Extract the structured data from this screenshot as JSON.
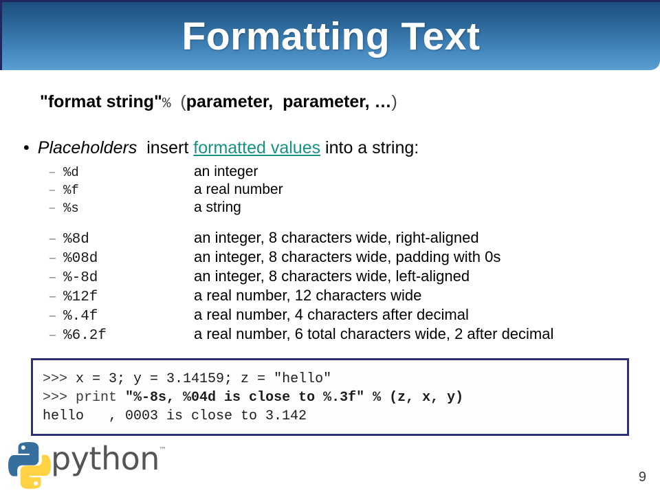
{
  "slide": {
    "title": "Formatting Text",
    "page_number": "9",
    "accent_banner_top": "#1d4f7e",
    "accent_banner_bottom": "#59a0d4",
    "accent_border": "#22265e",
    "link_color": "#169184",
    "code_border_color": "#2d3074"
  },
  "syntax": {
    "format_string": "\"format string\"",
    "percent": "%",
    "open_paren": "(",
    "param1": "parameter,",
    "param2": "parameter,",
    "ellipsis": "…",
    "close_paren": ")"
  },
  "bullet": {
    "dot": "•",
    "emphasis": "Placeholders",
    "text_before_link": "  insert ",
    "link": "formatted values",
    "text_after_link": " into a string:"
  },
  "placeholder_groups": [
    {
      "id": "basic",
      "rows": [
        {
          "dash": "–",
          "code": "%d",
          "desc": "an integer"
        },
        {
          "dash": "–",
          "code": "%f",
          "desc": "a real number"
        },
        {
          "dash": "–",
          "code": "%s",
          "desc": "a string"
        }
      ]
    },
    {
      "id": "widths",
      "rows": [
        {
          "dash": "–",
          "code": "%8d",
          "desc": "an integer, 8 characters wide, right-aligned"
        },
        {
          "dash": "–",
          "code": "%08d",
          "desc": "an integer, 8 characters wide, padding with 0s"
        },
        {
          "dash": "–",
          "code": "%-8d",
          "desc": "an integer, 8 characters wide, left-aligned"
        },
        {
          "dash": "–",
          "code": "%12f",
          "desc": "a real number, 12 characters wide"
        },
        {
          "dash": "–",
          "code": "%.4f",
          "desc": "a real number, 4 characters after decimal"
        },
        {
          "dash": "–",
          "code": "%6.2f",
          "desc": "a real number, 6 total characters wide, 2 after decimal"
        }
      ]
    }
  ],
  "code_console": {
    "line1_prompt": ">>> ",
    "line1_code": "x = 3; y = 3.14159; z = \"hello\"",
    "line2_prompt": ">>> ",
    "line2_keyword": "print ",
    "line2_bold": "\"%-8s, %04d is close to %.3f\" % (z, x, y)",
    "line3_output": "hello   , 0003 is close to 3.142"
  },
  "logo": {
    "wordmark": "python",
    "trademark": "™",
    "snake_blue": "#366F9E",
    "snake_yellow": "#FFD343"
  }
}
